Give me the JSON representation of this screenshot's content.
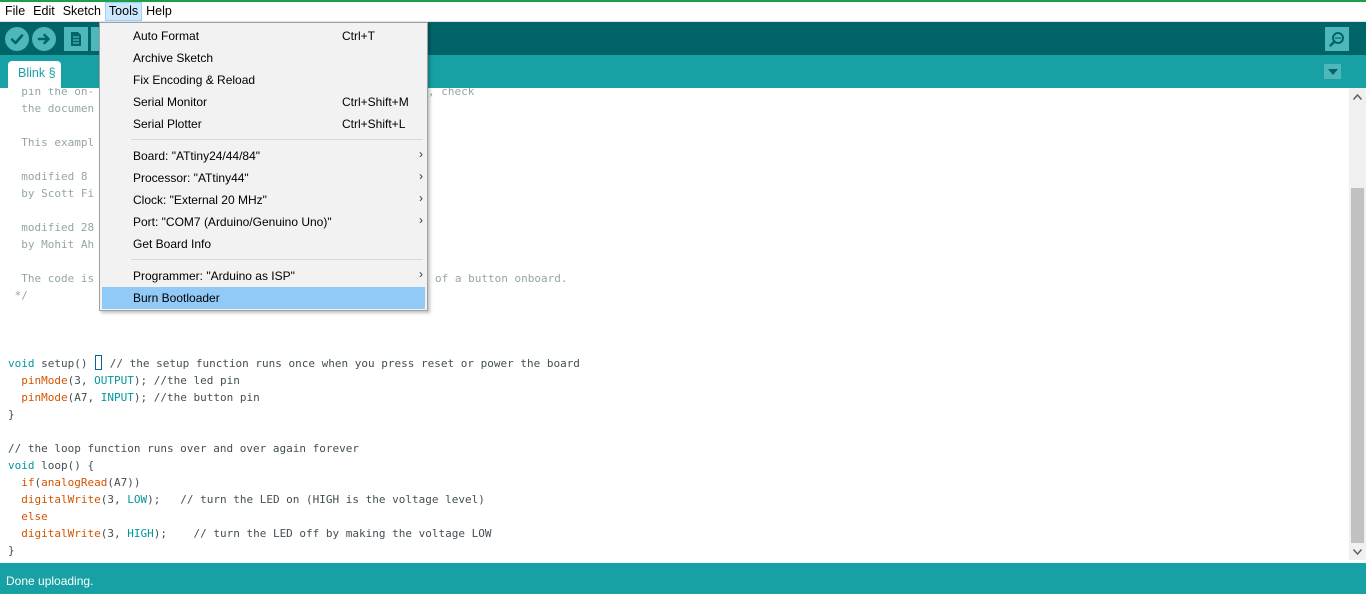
{
  "menubar": {
    "items": [
      "File",
      "Edit",
      "Sketch",
      "Tools",
      "Help"
    ],
    "active": "Tools"
  },
  "toolbar": {
    "buttons": [
      "verify-icon",
      "upload-icon",
      "new-icon",
      "open-icon",
      "serial-monitor-icon"
    ]
  },
  "tabs": [
    {
      "label": "Blink §"
    }
  ],
  "tools_menu": {
    "groups": [
      [
        {
          "label": "Auto Format",
          "shortcut": "Ctrl+T"
        },
        {
          "label": "Archive Sketch",
          "shortcut": ""
        },
        {
          "label": "Fix Encoding & Reload",
          "shortcut": ""
        },
        {
          "label": "Serial Monitor",
          "shortcut": "Ctrl+Shift+M"
        },
        {
          "label": "Serial Plotter",
          "shortcut": "Ctrl+Shift+L"
        }
      ],
      [
        {
          "label": "Board: \"ATtiny24/44/84\"",
          "submenu": true
        },
        {
          "label": "Processor: \"ATtiny44\"",
          "submenu": true
        },
        {
          "label": "Clock: \"External 20 MHz\"",
          "submenu": true
        },
        {
          "label": "Port: \"COM7 (Arduino/Genuino Uno)\"",
          "submenu": true
        },
        {
          "label": "Get Board Info",
          "submenu": false
        }
      ],
      [
        {
          "label": "Programmer: \"Arduino as ISP\"",
          "submenu": true
        },
        {
          "label": "Burn Bootloader",
          "submenu": false,
          "highlighted": true
        }
      ]
    ]
  },
  "editor": {
    "comment_lines": {
      "l1a": "  pin the on-",
      "l1b": ", check",
      "l2": "  the documen",
      "l3": "  This exampl",
      "l4": "  modified 8",
      "l5": "  by Scott Fi",
      "l6": "  modified 28",
      "l7": "  by Mohit Ah",
      "l8a": "  The code is",
      "l8b": "of a button onboard.",
      "l9": " */"
    },
    "code": {
      "setup_kw": "void",
      "setup_sig": " setup() ",
      "setup_comment": " // the setup function runs once when you press reset or power the board",
      "pm1_fn": "pinMode",
      "pm1_a": "(3, ",
      "pm1_k": "OUTPUT",
      "pm1_b": "); //the led pin",
      "pm2_fn": "pinMode",
      "pm2_a": "(A7, ",
      "pm2_k": "INPUT",
      "pm2_b": "); //the button pin",
      "close1": "}",
      "loop_comment": "// the loop function runs over and over again forever",
      "loop_kw": "void",
      "loop_sig": " loop() {",
      "if_kw": "if",
      "if_a": "(",
      "if_fn": "analogRead",
      "if_b": "(A7))",
      "dw1_fn": "digitalWrite",
      "dw1_a": "(3, ",
      "dw1_k": "LOW",
      "dw1_b": ");   // turn the LED on (HIGH is the voltage level)",
      "else_kw": "else",
      "dw2_fn": "digitalWrite",
      "dw2_a": "(3, ",
      "dw2_k": "HIGH",
      "dw2_b": ");    // turn the LED off by making the voltage LOW",
      "close2": "}"
    }
  },
  "status": {
    "text": "Done uploading."
  },
  "colors": {
    "toolbar": "#006468",
    "tabs_bar": "#17a1a5",
    "menu_highlight": "#91c9f7",
    "keyword": "#00979c",
    "function": "#d35400",
    "comment": "#95a5a6"
  }
}
